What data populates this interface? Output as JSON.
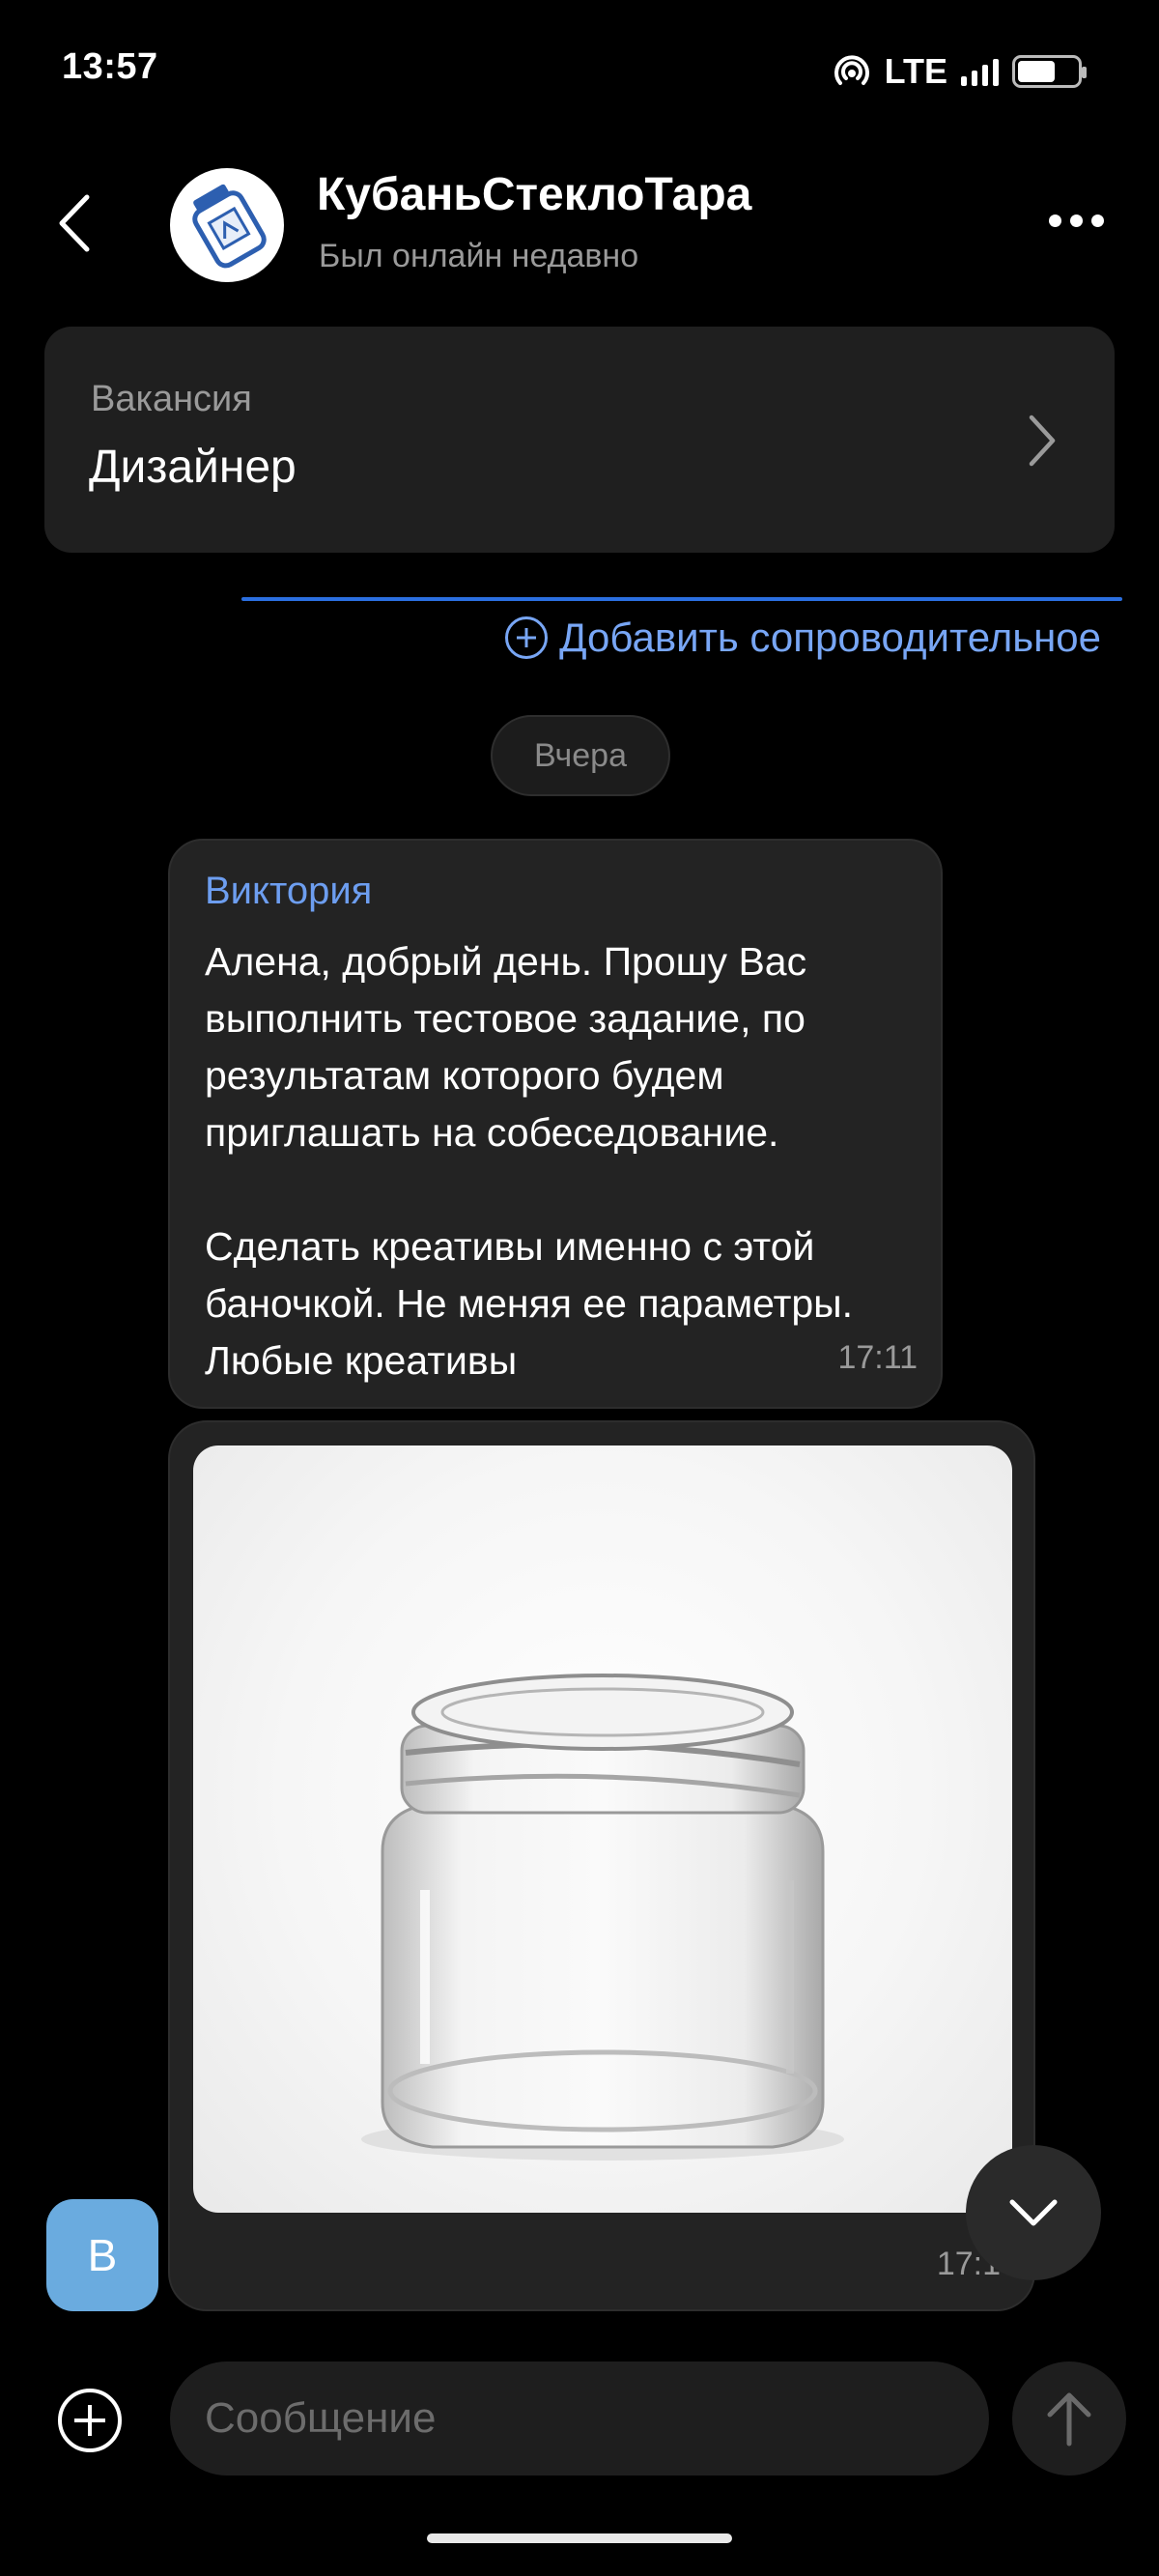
{
  "status_bar": {
    "time": "13:57",
    "network": "LTE"
  },
  "header": {
    "company": "КубаньСтеклоТара",
    "last_seen": "Был онлайн недавно"
  },
  "vacancy": {
    "label": "Вакансия",
    "title": "Дизайнер"
  },
  "cover_letter": {
    "label": "Добавить сопроводительное"
  },
  "date_separator": "Вчера",
  "messages": [
    {
      "sender": "Виктория",
      "text": "Алена, добрый день. Прошу Вас выполнить тестовое задание, по результатам которого будем приглашать на собеседование.\n\nСделать креативы именно с этой баночкой. Не меняя ее параметры. Любые креативы",
      "time": "17:11"
    },
    {
      "type": "image",
      "time": "17:1"
    }
  ],
  "sender_avatar_letter": "В",
  "composer": {
    "placeholder": "Сообщение"
  },
  "colors": {
    "background": "#000000",
    "bubble": "#232323",
    "accent": "#78a6f5",
    "sender_name": "#6d9ef0",
    "avatar": "#6aabdf"
  },
  "icons": [
    "back-arrow-icon",
    "more-dots-icon",
    "chevron-right-icon",
    "plus-circle-icon",
    "chevron-down-icon",
    "attach-plus-icon",
    "send-arrow-icon"
  ]
}
